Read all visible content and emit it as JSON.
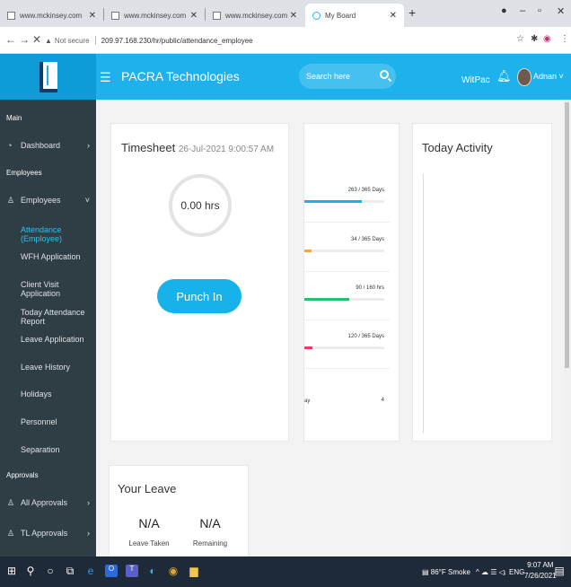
{
  "browser": {
    "tabs": [
      {
        "title": "www.mckinsey.com"
      },
      {
        "title": "www.mckinsey.com"
      },
      {
        "title": "www.mckinsey.com"
      },
      {
        "title": "My Board"
      }
    ],
    "address": {
      "security": "Not secure",
      "url": "209.97.168.230/hr/public/attendance_employee"
    }
  },
  "header": {
    "company": "PACRA Technologies",
    "search_placeholder": "Search here",
    "language": "WitPac",
    "user_name": "Adnan"
  },
  "sidebar": {
    "main_title": "Main",
    "dashboard": "Dashboard",
    "employees_title": "Employees",
    "employees": "Employees",
    "sub_items": [
      "Attendance (Employee)",
      "WFH Application",
      "Client Visit Application",
      "Today Attendance Report",
      "Leave Application",
      "Leave History",
      "Holidays",
      "Personnel",
      "Separation"
    ],
    "approvals_title": "Approvals",
    "all_approvals": "All Approvals",
    "tl_approvals": "TL Approvals"
  },
  "timesheet": {
    "title": "Timesheet",
    "date": "26-Jul-2021 9:00:57 AM",
    "hours": "0.00 hrs",
    "punch_label": "Punch In"
  },
  "statistics": {
    "rows": [
      {
        "value": "263 / 365 Days",
        "fraction": 0.72,
        "color": "#1ab3e8"
      },
      {
        "value": "34 / 365 Days",
        "fraction": 0.09,
        "color": "#f0a93b"
      },
      {
        "value": "90 / 160 hrs",
        "fraction": 0.56,
        "color": "#22c16b"
      },
      {
        "value": "120 / 365 Days",
        "fraction": 0.1,
        "color": "#f0386b"
      },
      {
        "value": "4",
        "label_fragment": "ay",
        "fraction": 0
      }
    ]
  },
  "activity": {
    "title": "Today Activity"
  },
  "leaves": {
    "title": "Your Leave",
    "taken_value": "N/A",
    "taken_label": "Leave Taken",
    "remaining_value": "N/A",
    "remaining_label": "Remaining"
  },
  "taskbar": {
    "weather": "86°F Smoke",
    "lang": "ENG",
    "time": "9:07 AM",
    "date": "7/26/2021"
  }
}
